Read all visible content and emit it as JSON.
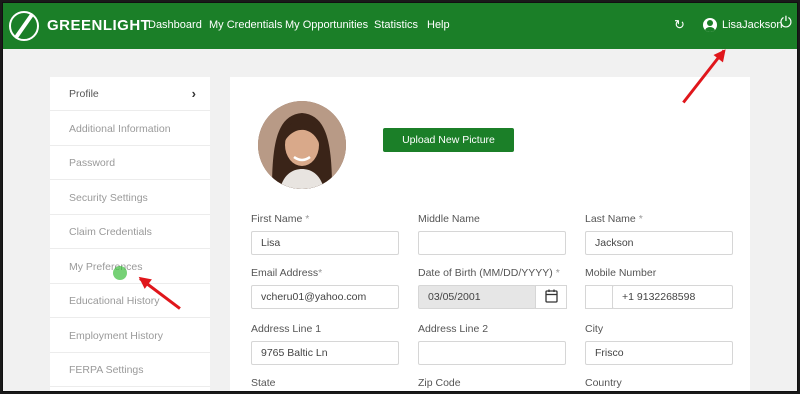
{
  "app": {
    "brand": "GREENLIGHT",
    "accent_color": "#1b7f28"
  },
  "nav": {
    "items": [
      "Dashboard",
      "My Credentials",
      "My Opportunities",
      "Statistics",
      "Help"
    ],
    "username": "LisaJackson",
    "refresh_icon": "refresh-icon",
    "user_icon": "user-circle-icon",
    "power_icon": "power-icon"
  },
  "sidebar": {
    "items": [
      {
        "label": "Profile"
      },
      {
        "label": "Additional Information"
      },
      {
        "label": "Password"
      },
      {
        "label": "Security Settings"
      },
      {
        "label": "Claim Credentials"
      },
      {
        "label": "My Preferences"
      },
      {
        "label": "Educational History"
      },
      {
        "label": "Employment History"
      },
      {
        "label": "FERPA Settings"
      }
    ]
  },
  "profile": {
    "upload_label": "Upload New Picture",
    "fields": {
      "first_name": {
        "label": "First Name",
        "required": "*",
        "value": "Lisa"
      },
      "middle_name": {
        "label": "Middle Name",
        "value": ""
      },
      "last_name": {
        "label": "Last Name",
        "required": "*",
        "value": "Jackson"
      },
      "email": {
        "label": "Email Address",
        "required": "*",
        "value": "vcheru01@yahoo.com"
      },
      "dob": {
        "label": "Date of Birth (MM/DD/YYYY)",
        "required": "*",
        "value": "03/05/2001"
      },
      "mobile": {
        "label": "Mobile Number",
        "value": "+1 9132268598"
      },
      "address1": {
        "label": "Address Line 1",
        "value": "9765 Baltic Ln"
      },
      "address2": {
        "label": "Address Line 2",
        "value": ""
      },
      "city": {
        "label": "City",
        "value": "Frisco"
      },
      "state": {
        "label": "State"
      },
      "zip": {
        "label": "Zip Code"
      },
      "country": {
        "label": "Country"
      }
    }
  },
  "annotation": {
    "arrow_color": "#e0161b"
  }
}
